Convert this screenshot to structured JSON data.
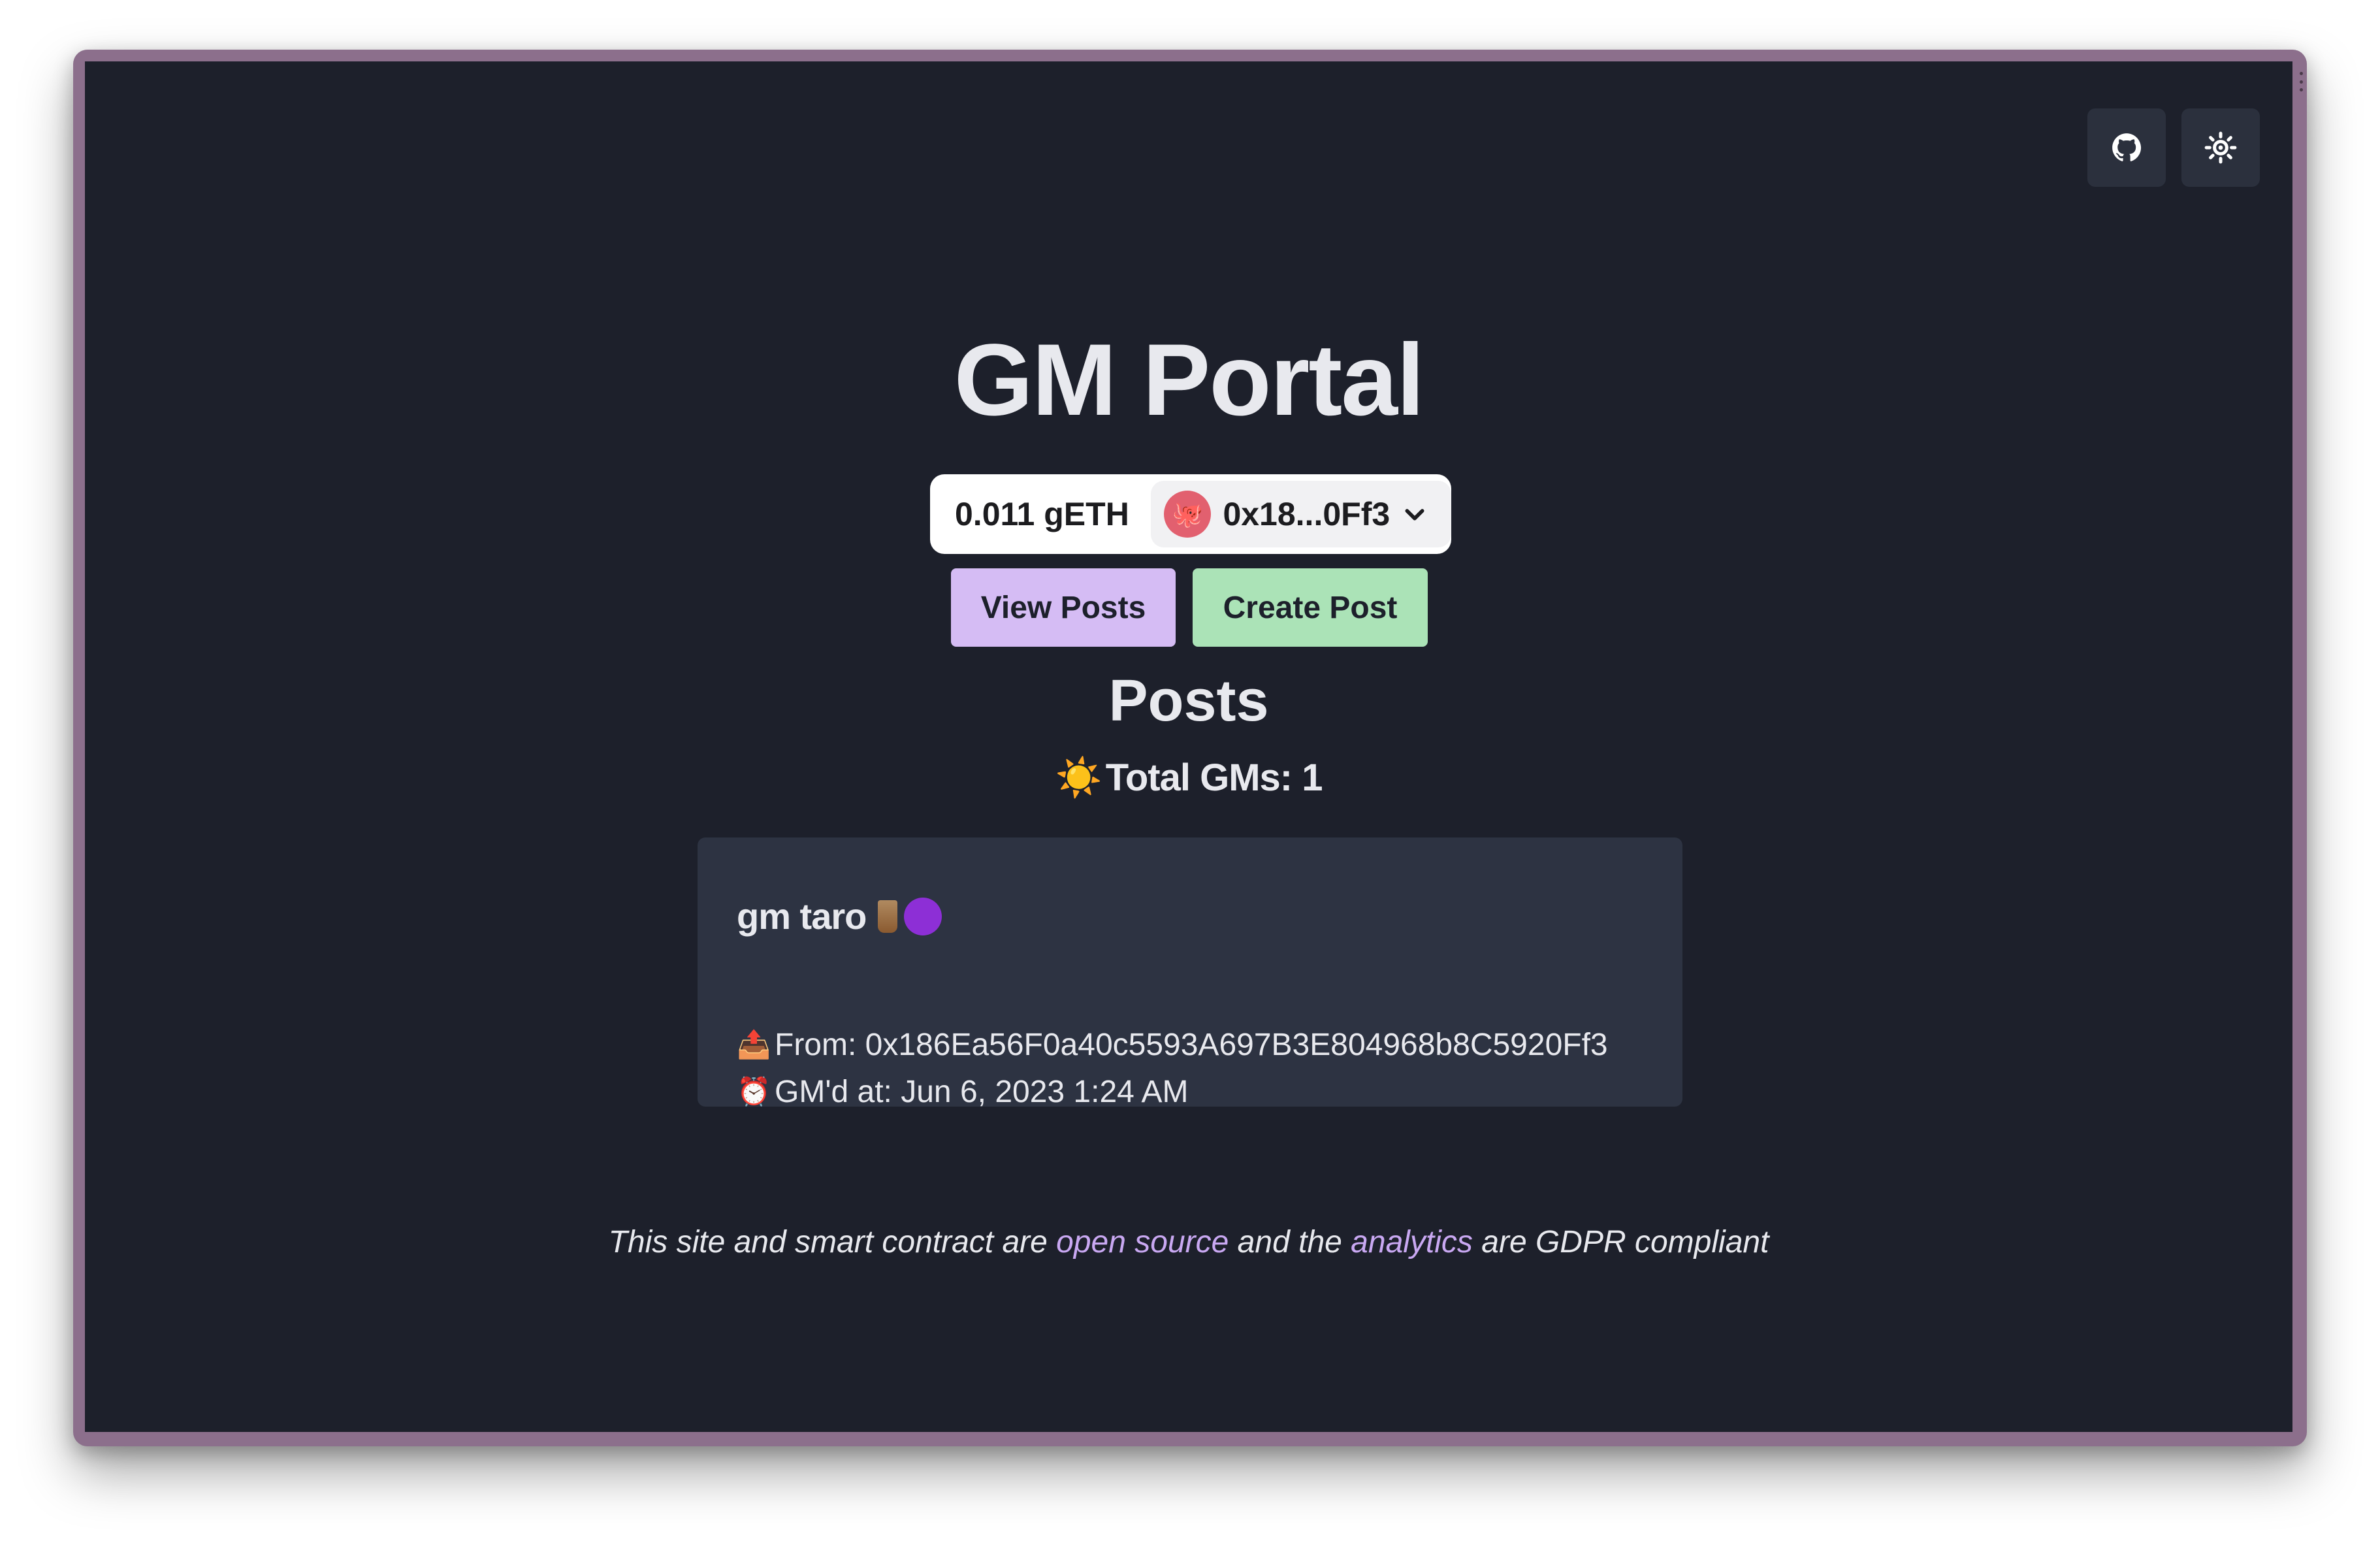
{
  "header": {
    "github_icon": "github-icon",
    "theme_icon": "sun-icon"
  },
  "app": {
    "title": "GM Portal"
  },
  "wallet": {
    "balance": "0.011 gETH",
    "address": "0x18...0Ff3",
    "avatar_glyph": "🐙"
  },
  "actions": {
    "view_posts": "View Posts",
    "create_post": "Create Post"
  },
  "posts": {
    "heading": "Posts",
    "total_icon": "☀️",
    "total_label": "Total GMs: 1",
    "items": [
      {
        "message": "gm taro",
        "from_icon": "📤",
        "from_label": "From: 0x186Ea56F0a40c5593A697B3E804968b8C5920Ff3",
        "time_icon": "⏰",
        "time_label": "GM'd at: Jun 6, 2023 1:24 AM"
      }
    ]
  },
  "footer": {
    "text_1": "This site and smart contract are ",
    "link_open_source": "open source",
    "text_2": " and the ",
    "link_analytics": "analytics",
    "text_3": " are GDPR compliant"
  },
  "colors": {
    "background": "#1d202b",
    "card": "#2d3342",
    "view_button": "#d5bcf4",
    "create_button": "#abe3b7",
    "link": "#c9a8f2"
  }
}
